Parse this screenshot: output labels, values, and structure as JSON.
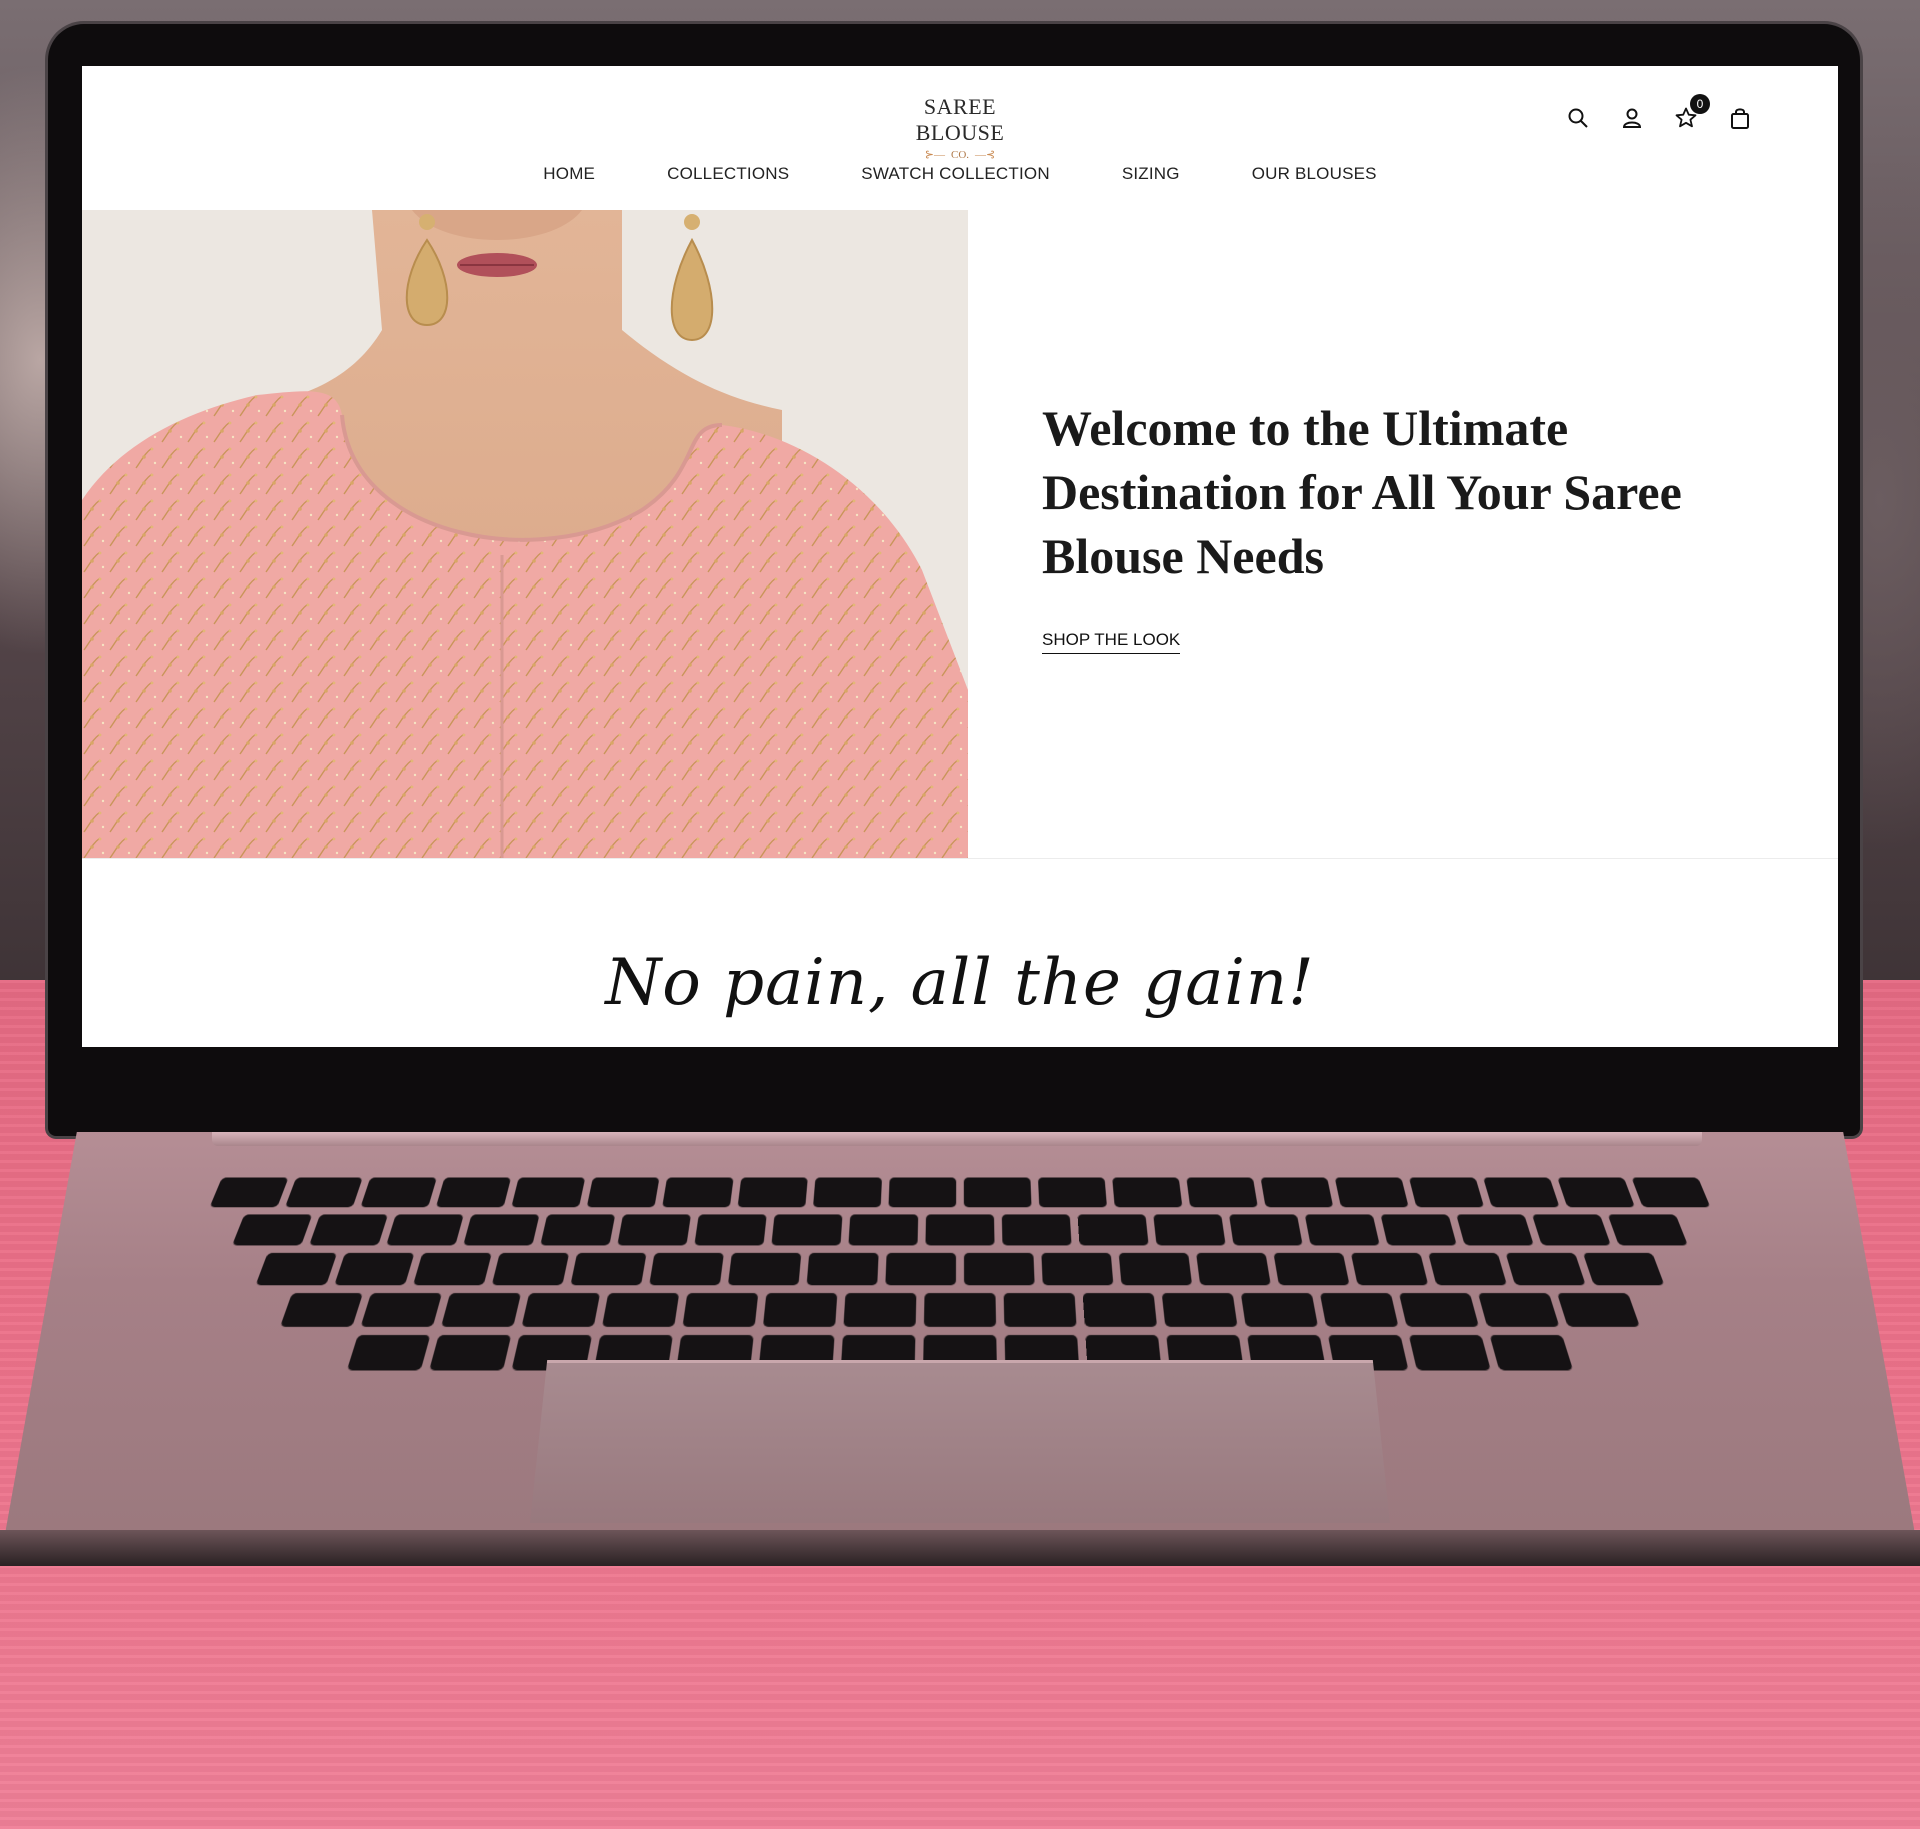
{
  "brand": {
    "logo_main": "SAREE BLOUSE",
    "logo_sub": "CO."
  },
  "header": {
    "icons": [
      "search-icon",
      "account-icon",
      "wishlist-icon",
      "cart-icon"
    ],
    "wishlist_count": "0"
  },
  "nav": {
    "items": [
      {
        "label": "HOME"
      },
      {
        "label": "COLLECTIONS"
      },
      {
        "label": "SWATCH COLLECTION"
      },
      {
        "label": "SIZING"
      },
      {
        "label": "OUR BLOUSES"
      }
    ]
  },
  "hero": {
    "title": "Welcome to the Ultimate Destination for All Your Saree Blouse Needs",
    "cta": "SHOP THE LOOK"
  },
  "tagline": "No pain, all the gain!",
  "colors": {
    "blouse": "#f0a9a4",
    "embroidery": "#c9955a",
    "table": "#ec7189"
  }
}
